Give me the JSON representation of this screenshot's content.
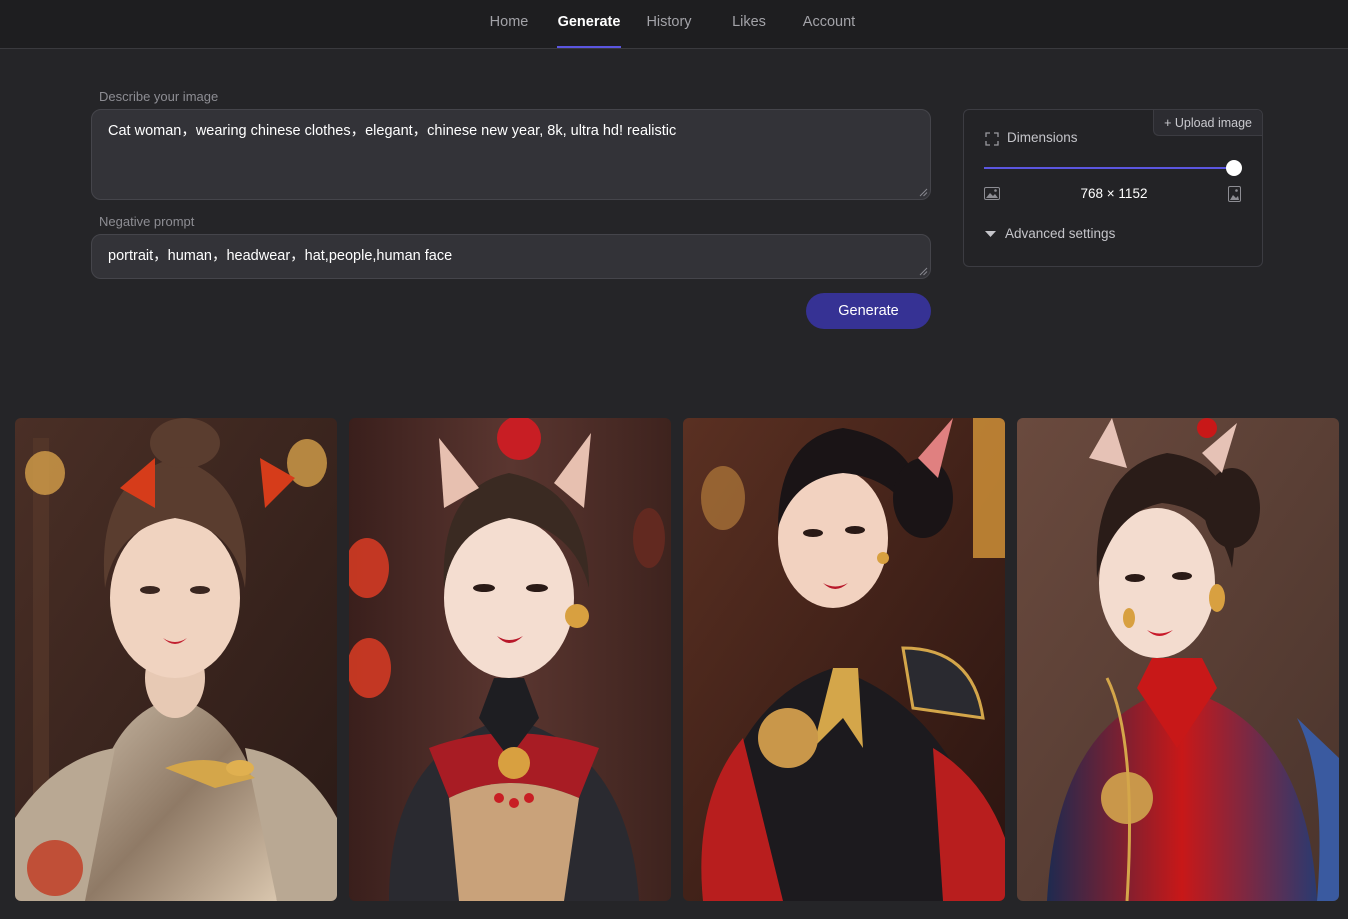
{
  "nav": {
    "items": [
      {
        "label": "Home"
      },
      {
        "label": "Generate"
      },
      {
        "label": "History"
      },
      {
        "label": "Likes"
      },
      {
        "label": "Account"
      }
    ],
    "active": "Generate"
  },
  "prompt": {
    "label": "Describe your image",
    "value": "Cat woman，wearing chinese clothes，elegant，chinese new year, 8k, ultra hd! realistic"
  },
  "negative": {
    "label": "Negative prompt",
    "value": "portrait，human，headwear，hat,people,human face"
  },
  "generate_label": "Generate",
  "settings": {
    "upload_label": "+ Upload image",
    "dimensions_label": "Dimensions",
    "size_value": "768 × 1152",
    "slider_level": 1.0,
    "advanced_label": "Advanced settings"
  },
  "gallery": {
    "count": 4
  },
  "colors": {
    "accent": "#5b56e0",
    "button": "#363294",
    "background": "#252528"
  },
  "icons": [
    "expand-icon",
    "landscape-image-icon",
    "portrait-image-icon",
    "caret-down-icon",
    "resize-grip-icon"
  ]
}
